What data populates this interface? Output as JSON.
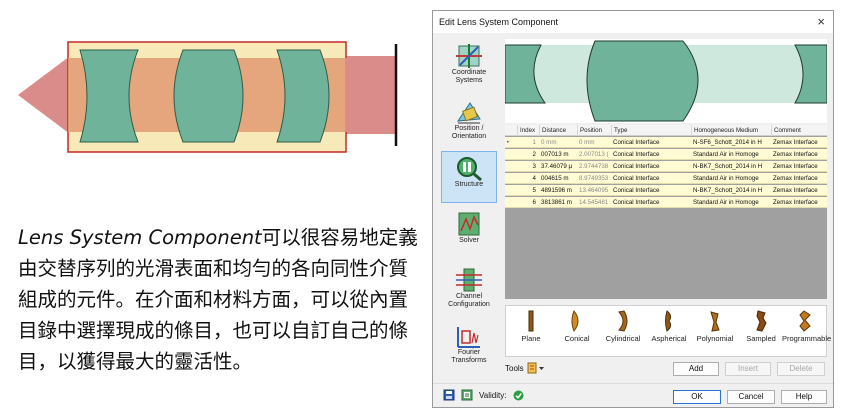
{
  "caption": {
    "italic_part": "Lens System Component",
    "rest": "可以很容易地定義由交替序列的光滑表面和均勻的各向同性介質組成的元件。在介面和材料方面，可以從內置目錄中選擇現成的條目，也可以自訂自己的條目，以獲得最大的靈活性。"
  },
  "dialog": {
    "title": "Edit Lens System Component",
    "close_glyph": "×",
    "sidebar": [
      {
        "label_1": "Coordinate",
        "label_2": "Systems",
        "icon": "coordinate-systems-icon",
        "active": false
      },
      {
        "label_1": "Position /",
        "label_2": "Orientation",
        "icon": "position-orientation-icon",
        "active": false
      },
      {
        "label_1": "Structure",
        "label_2": "",
        "icon": "structure-icon",
        "active": true
      },
      {
        "label_1": "Solver",
        "label_2": "",
        "icon": "solver-icon",
        "active": false
      },
      {
        "label_1": "Channel",
        "label_2": "Configuration",
        "icon": "channel-configuration-icon",
        "active": false
      },
      {
        "label_1": "Fourier",
        "label_2": "Transforms",
        "icon": "fourier-transforms-icon",
        "active": false
      }
    ],
    "table": {
      "columns": [
        "Index",
        "Distance",
        "Position",
        "Type",
        "Homogeneous Medium",
        "Comment"
      ],
      "rows": [
        {
          "index": "1",
          "distance": "0 mm",
          "position": "0 mm",
          "type": "Conical Interface",
          "medium": "N-SF6_Schott_2014 in H",
          "comment": "Zemax Interface"
        },
        {
          "index": "2",
          "distance": "007013 m",
          "position": "2.007013 (",
          "type": "Conical Interface",
          "medium": "Standard Air in Homoge",
          "comment": "Zemax Interface"
        },
        {
          "index": "3",
          "distance": "37.46079 µ",
          "position": "2.9744738",
          "type": "Conical Interface",
          "medium": "N-BK7_Schott_2014 in H",
          "comment": "Zemax Interface"
        },
        {
          "index": "4",
          "distance": "004615 m",
          "position": "8.9749353",
          "type": "Conical Interface",
          "medium": "Standard Air in Homoge",
          "comment": "Zemax Interface"
        },
        {
          "index": "5",
          "distance": "4891596 m",
          "position": "13.464095",
          "type": "Conical Interface",
          "medium": "N-BK7_Schott_2014 in H",
          "comment": "Zemax Interface"
        },
        {
          "index": "6",
          "distance": "3813861 m",
          "position": "14.545481",
          "type": "Conical Interface",
          "medium": "Standard Air in Homoge",
          "comment": "Zemax Interface"
        }
      ]
    },
    "surface_types": [
      "Plane",
      "Conical",
      "Cylindrical",
      "Aspherical",
      "Polynomial",
      "Sampled",
      "Programmable"
    ],
    "tools_label": "Tools",
    "add_label": "Add",
    "insert_label": "Insert",
    "delete_label": "Delete",
    "validity_label": "Validity:",
    "ok_label": "OK",
    "cancel_label": "Cancel",
    "help_label": "Help"
  },
  "colors": {
    "lens": "#6fb39a",
    "lens_edge": "#2e5b4a",
    "beam_outer": "#d98c8a",
    "beam_inner": "#e09a6e",
    "box_fill": "#f8e9b8",
    "box_border": "#c62828",
    "table_row": "#fffbd4",
    "active_tab": "#cde4f7"
  }
}
